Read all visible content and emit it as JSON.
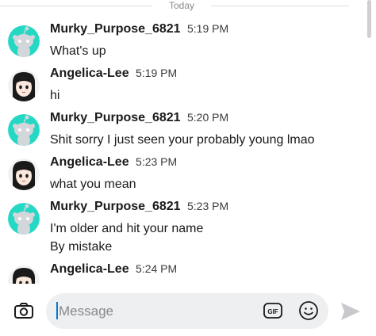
{
  "divider": {
    "label": "Today"
  },
  "messages": [
    {
      "author": "Murky_Purpose_6821",
      "time": "5:19 PM",
      "lines": [
        "What's up"
      ],
      "avatar": "snoo-avatar-icon"
    },
    {
      "author": "Angelica-Lee",
      "time": "5:19 PM",
      "lines": [
        "hi"
      ],
      "avatar": "anime-girl-avatar-icon"
    },
    {
      "author": "Murky_Purpose_6821",
      "time": "5:20 PM",
      "lines": [
        "Shit sorry I just seen your probably young lmao"
      ],
      "avatar": "snoo-avatar-icon"
    },
    {
      "author": "Angelica-Lee",
      "time": "5:23 PM",
      "lines": [
        "what you mean"
      ],
      "avatar": "anime-girl-avatar-icon"
    },
    {
      "author": "Murky_Purpose_6821",
      "time": "5:23 PM",
      "lines": [
        "I'm older and hit your name",
        "By mistake"
      ],
      "avatar": "snoo-avatar-icon"
    },
    {
      "author": "Angelica-Lee",
      "time": "5:24 PM",
      "lines": [],
      "avatar": "anime-girl-avatar-icon"
    }
  ],
  "composer": {
    "placeholder": "Message",
    "gif_label": "GIF",
    "icons": [
      "camera-icon",
      "gif-icon",
      "emoji-icon",
      "send-icon"
    ]
  },
  "colors": {
    "snoo_bg": "#24d8c3",
    "accent": "#0079d3",
    "input_bg": "#edeff1"
  }
}
